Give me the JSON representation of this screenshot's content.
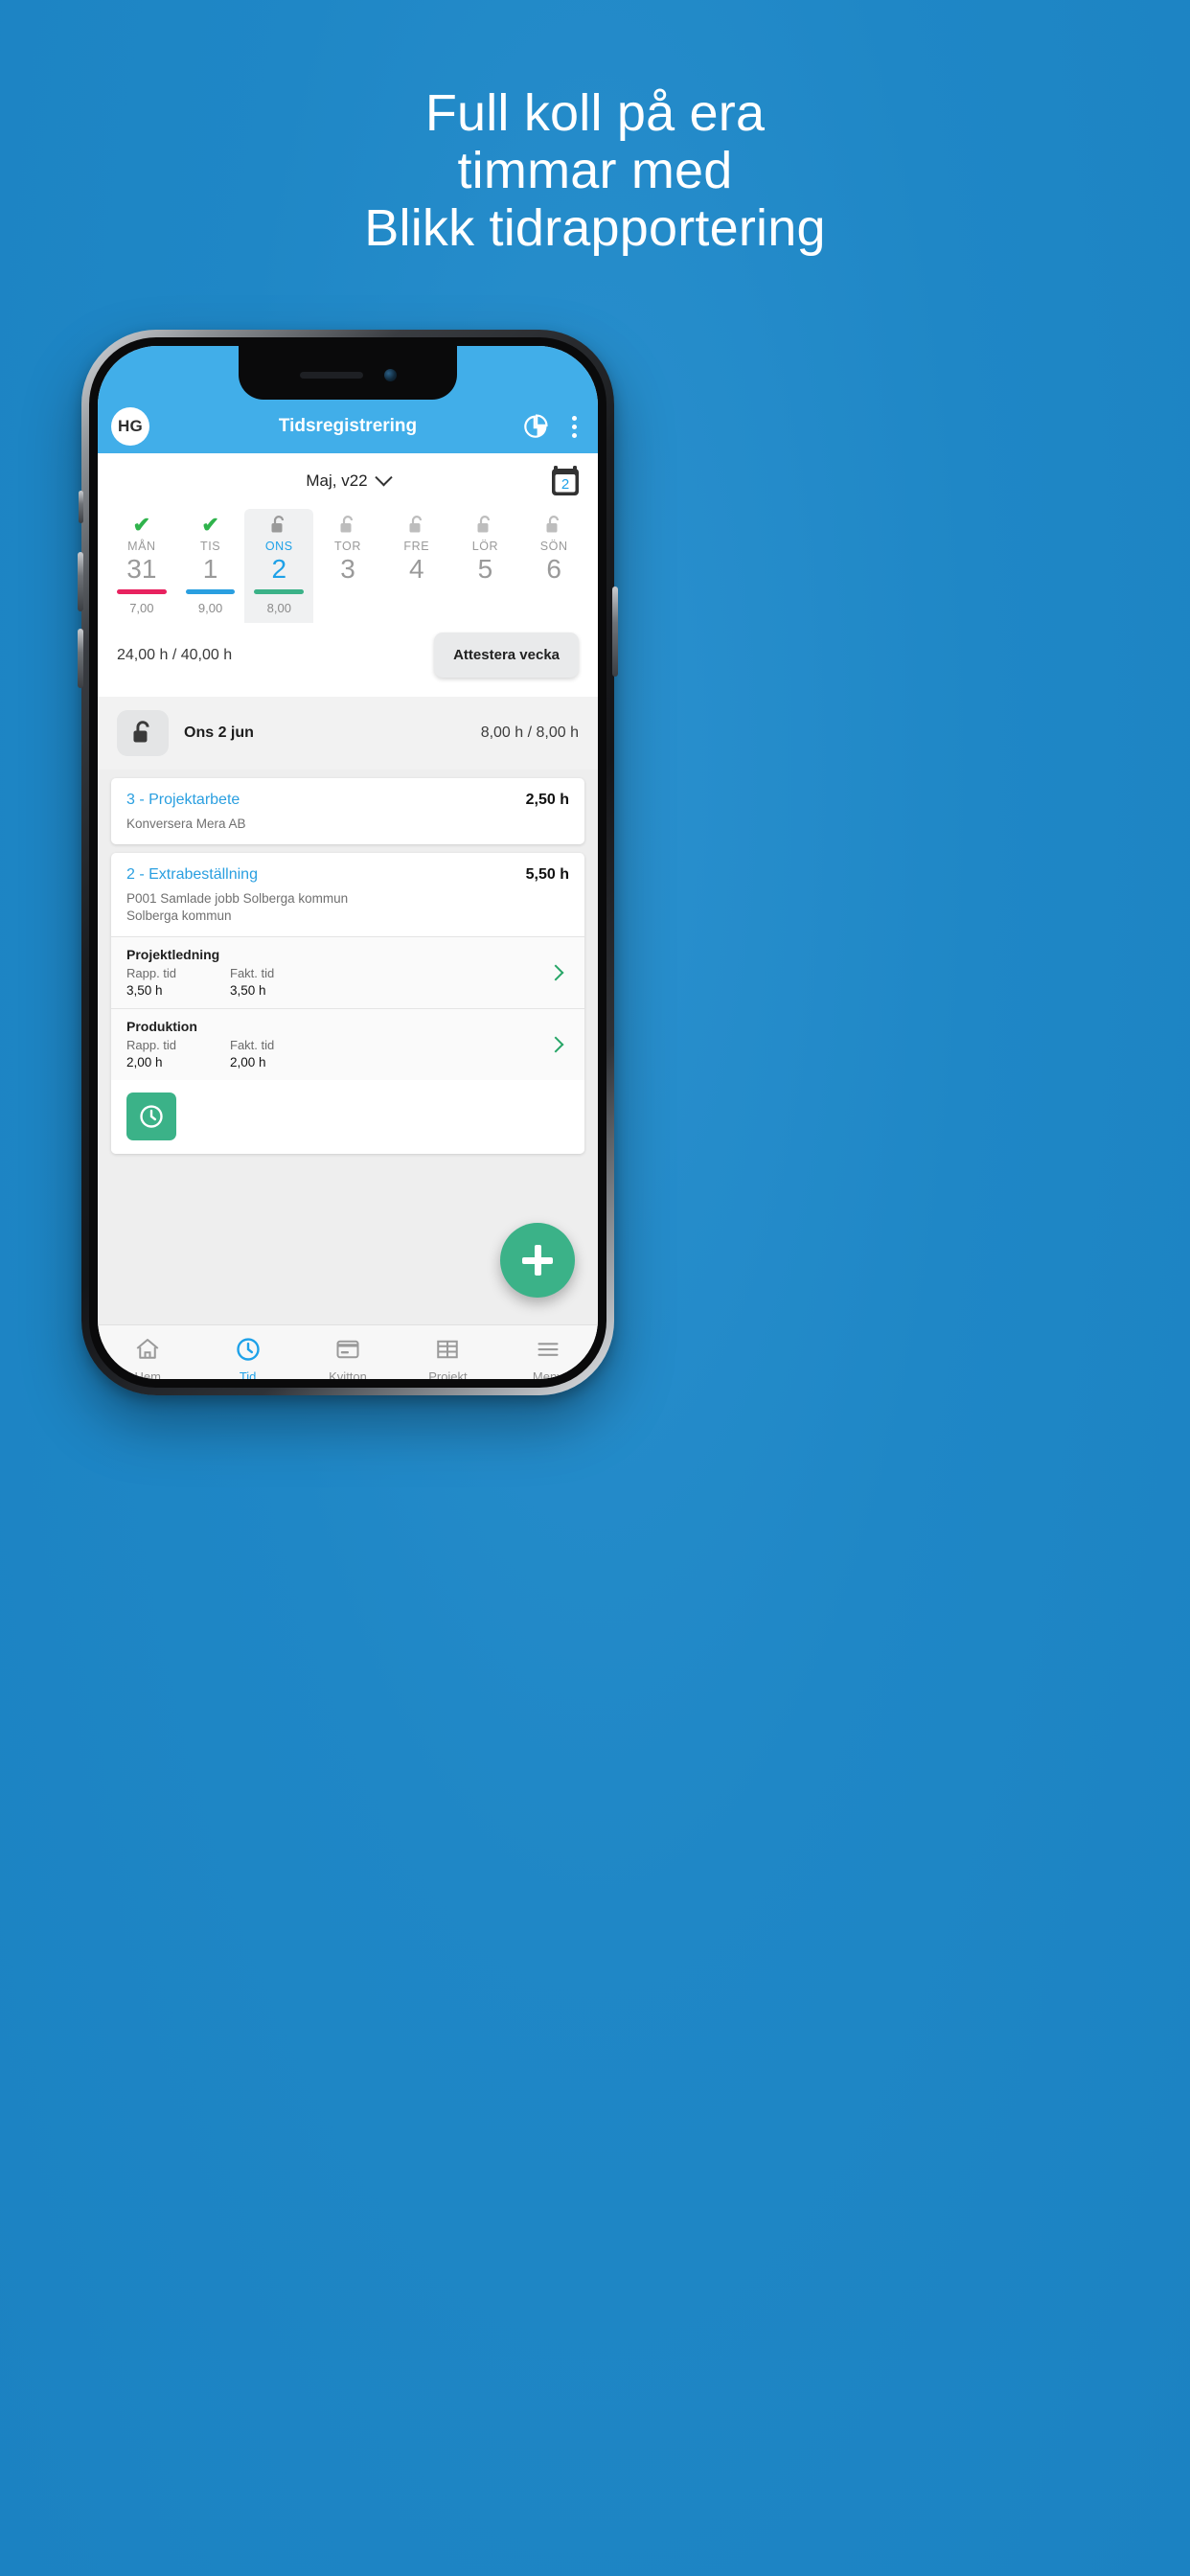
{
  "promo": {
    "headline_lines": [
      "Full koll på era",
      "timmar med",
      "Blikk tidrapportering"
    ],
    "background_color": "#1f87c6"
  },
  "app": {
    "accent_blue": "#41aee9",
    "link_blue": "#2a9fe0",
    "green": "#3bb288",
    "appbar": {
      "avatar_initials": "HG",
      "title": "Tidsregistrering",
      "chart_icon": "pie-chart-icon",
      "overflow_icon": "more-vertical-icon"
    },
    "week": {
      "period_label": "Maj, v22",
      "dropdown_icon": "chevron-down-icon",
      "calendar_icon_day": "2",
      "days": [
        {
          "name": "MÅN",
          "num": "31",
          "hours": "7,00",
          "status": "check",
          "bar_color": "#e8225f",
          "selected": false
        },
        {
          "name": "TIS",
          "num": "1",
          "hours": "9,00",
          "status": "check",
          "bar_color": "#2a9fe0",
          "selected": false
        },
        {
          "name": "ONS",
          "num": "2",
          "hours": "8,00",
          "status": "unlock",
          "bar_color": "#3bb288",
          "selected": true
        },
        {
          "name": "TOR",
          "num": "3",
          "hours": "",
          "status": "unlock",
          "bar_color": "",
          "selected": false
        },
        {
          "name": "FRE",
          "num": "4",
          "hours": "",
          "status": "unlock",
          "bar_color": "",
          "selected": false
        },
        {
          "name": "LÖR",
          "num": "5",
          "hours": "",
          "status": "unlock",
          "bar_color": "",
          "selected": false
        },
        {
          "name": "SÖN",
          "num": "6",
          "hours": "",
          "status": "unlock",
          "bar_color": "",
          "selected": false
        }
      ],
      "total_text": "24,00 h / 40,00 h",
      "attest_button_label": "Attestera vecka"
    },
    "day_header": {
      "lock_icon": "unlock-icon",
      "title": "Ons 2 jun",
      "hours": "8,00 h / 8,00 h"
    },
    "entries": [
      {
        "title": "3 - Projektarbete",
        "hours": "2,50 h",
        "sub_lines": [
          "Konversera Mera AB"
        ],
        "rows": []
      },
      {
        "title": "2 - Extrabeställning",
        "hours": "5,50 h",
        "sub_lines": [
          "P001 Samlade jobb Solberga kommun",
          "Solberga kommun"
        ],
        "rows": [
          {
            "title": "Projektledning",
            "col1_label": "Rapp. tid",
            "col1_value": "3,50 h",
            "col2_label": "Fakt. tid",
            "col2_value": "3,50 h",
            "chevron_icon": "chevron-right-icon"
          },
          {
            "title": "Produktion",
            "col1_label": "Rapp. tid",
            "col1_value": "2,00 h",
            "col2_label": "Fakt. tid",
            "col2_value": "2,00 h",
            "chevron_icon": "chevron-right-icon"
          }
        ],
        "timer_icon": "clock-icon"
      }
    ],
    "fab": {
      "icon": "plus-icon"
    },
    "bottom_nav": [
      {
        "label": "Hem",
        "icon": "home-icon",
        "active": false
      },
      {
        "label": "Tid",
        "icon": "clock-icon",
        "active": true
      },
      {
        "label": "Kvitton",
        "icon": "receipt-icon",
        "active": false
      },
      {
        "label": "Projekt",
        "icon": "table-icon",
        "active": false
      },
      {
        "label": "Meny",
        "icon": "menu-icon",
        "active": false
      }
    ]
  }
}
